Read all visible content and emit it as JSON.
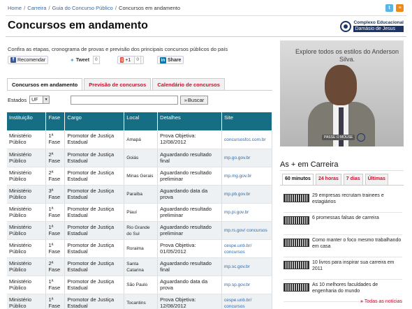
{
  "breadcrumb": [
    "Home",
    "Carreira",
    "Guia do Concurso Público",
    "Concursos em andamento"
  ],
  "title": "Concursos em andamento",
  "logo": {
    "line1": "Complexo Educacional",
    "line2": "Damásio de Jesus"
  },
  "intro": "Confira as etapas, cronograma de provas e previsão dos principais concursos públicos do país",
  "share": {
    "facebook": "Recomendar",
    "twitter": "Tweet",
    "twitter_count": "0",
    "gplus": "+1",
    "gplus_count": "0",
    "linkedin": "Share"
  },
  "tabs": [
    "Concursos em andamento",
    "Previsão de concursos",
    "Calendário de concursos"
  ],
  "filters": {
    "estados_label": "Estados",
    "uf_value": "UF",
    "search_button": "Buscar"
  },
  "table": {
    "headers": [
      "Instituição",
      "Fase",
      "Cargo",
      "Local",
      "Detalhes",
      "Site"
    ],
    "rows": [
      {
        "inst": "Ministério Público",
        "fase": "1ª Fase",
        "cargo": "Promotor de Justiça Estadual",
        "local": "Amapá",
        "det": "Prova Objetiva: 12/08/2012",
        "site": "concursosfcc.com.br"
      },
      {
        "inst": "Ministério Público",
        "fase": "2ª Fase",
        "cargo": "Promotor de Justiça Estadual",
        "local": "Goiás",
        "det": "Aguardando resultado final",
        "site": "mp.go.gov.br"
      },
      {
        "inst": "Ministério Público",
        "fase": "2ª Fase",
        "cargo": "Promotor de Justiça Estadual",
        "local": "Minas Gerais",
        "det": "Aguardando resultado preliminar",
        "site": "mp.mg.gov.br"
      },
      {
        "inst": "Ministério Público",
        "fase": "3ª Fase",
        "cargo": "Promotor de Justiça Estadual",
        "local": "Paraíba",
        "det": "Aguardando data da prova",
        "site": "mp.pb.gov.br"
      },
      {
        "inst": "Ministério Público",
        "fase": "1ª Fase",
        "cargo": "Promotor de Justiça Estadual",
        "local": "Piauí",
        "det": "Aguardando resultado preliminar",
        "site": "mp.pi.gov.br"
      },
      {
        "inst": "Ministério Público",
        "fase": "1ª Fase",
        "cargo": "Promotor de Justiça Estadual",
        "local": "Rio Grande do Sul",
        "det": "Aguardando resultado preliminar",
        "site": "mp.rs.gov/ concursos"
      },
      {
        "inst": "Ministério Público",
        "fase": "1ª Fase",
        "cargo": "Promotor de Justiça Estadual",
        "local": "Roraima",
        "det": "Prova Objetiva: 01/05/2012",
        "site": "cespe.unb.br/ concursos"
      },
      {
        "inst": "Ministério Público",
        "fase": "2ª Fase",
        "cargo": "Promotor de Justiça Estadual",
        "local": "Santa Catarina",
        "det": "Aguardando resultado final",
        "site": "mp.sc.gov.br"
      },
      {
        "inst": "Ministério Público",
        "fase": "1ª Fase",
        "cargo": "Promotor de Justiça Estadual",
        "local": "São Paulo",
        "det": "Aguardando data da prova",
        "site": "mp.sp.gov.br"
      },
      {
        "inst": "Ministério Público",
        "fase": "1ª Fase",
        "cargo": "Promotor de Justiça Estadual",
        "local": "Tocantins",
        "det": "Prova Objetiva: 12/08/2012",
        "site": "cespe.unb.br/ concursos"
      }
    ]
  },
  "ad": {
    "text": "Explore todos os estilos do Anderson Silva.",
    "button": "PASSE O MOUSE"
  },
  "mais": {
    "title": "As + em Carreira",
    "tabs": [
      "60 minutos",
      "24 horas",
      "7 dias",
      "Últimas"
    ],
    "items": [
      "29 empresas recrutam trainees e estagiários",
      "6 promessas falsas de carreira",
      "Como manter o foco mesmo trabalhando em casa",
      "10 livros para inspirar sua carreira em 2011",
      "As 10 melhores faculdades de engenharia do mundo"
    ],
    "all_link": "Todas as notícias"
  }
}
